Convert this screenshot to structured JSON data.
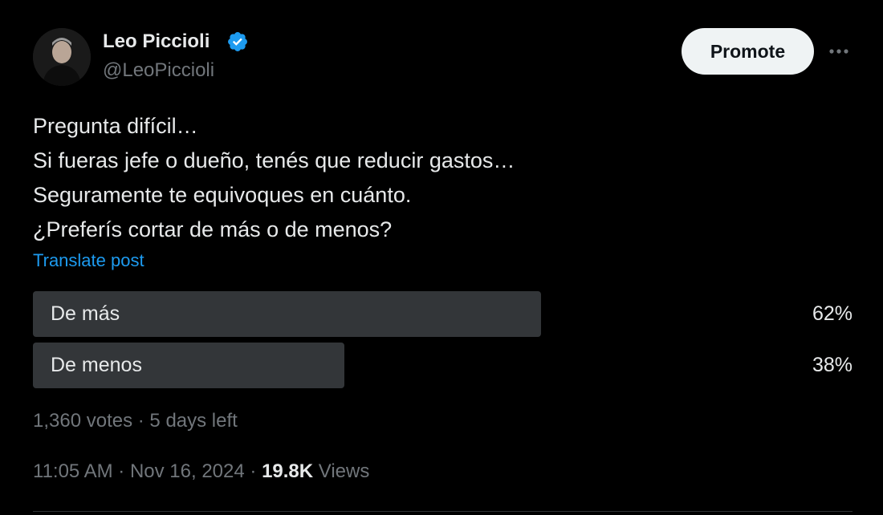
{
  "author": {
    "display_name": "Leo Piccioli",
    "handle": "@LeoPiccioli",
    "verified_icon": "verified-badge-icon",
    "verified_color": "#1d9bf0"
  },
  "header": {
    "promote_label": "Promote",
    "more_icon": "more-horizontal-icon"
  },
  "tweet": {
    "lines": [
      "Pregunta difícil…",
      "Si fueras jefe o dueño, tenés que reducir gastos…",
      "Seguramente te equivoques en cuánto.",
      "¿Preferís cortar de más o de menos?"
    ],
    "translate_label": "Translate post"
  },
  "poll": {
    "options": [
      {
        "label": "De más",
        "percent_label": "62%",
        "share": 0.62
      },
      {
        "label": "De menos",
        "percent_label": "38%",
        "share": 0.38
      }
    ],
    "votes": "1,360 votes",
    "separator": " · ",
    "time_left": "5 days left"
  },
  "meta": {
    "time": "11:05 AM",
    "separator": " · ",
    "date": "Nov 16, 2024",
    "views_count": "19.8K",
    "views_label": " Views"
  },
  "colors": {
    "background": "#000000",
    "text": "#e7e9ea",
    "muted": "#71767b",
    "accent": "#1d9bf0",
    "poll_bar": "#333639",
    "button_bg": "#eff3f4"
  }
}
